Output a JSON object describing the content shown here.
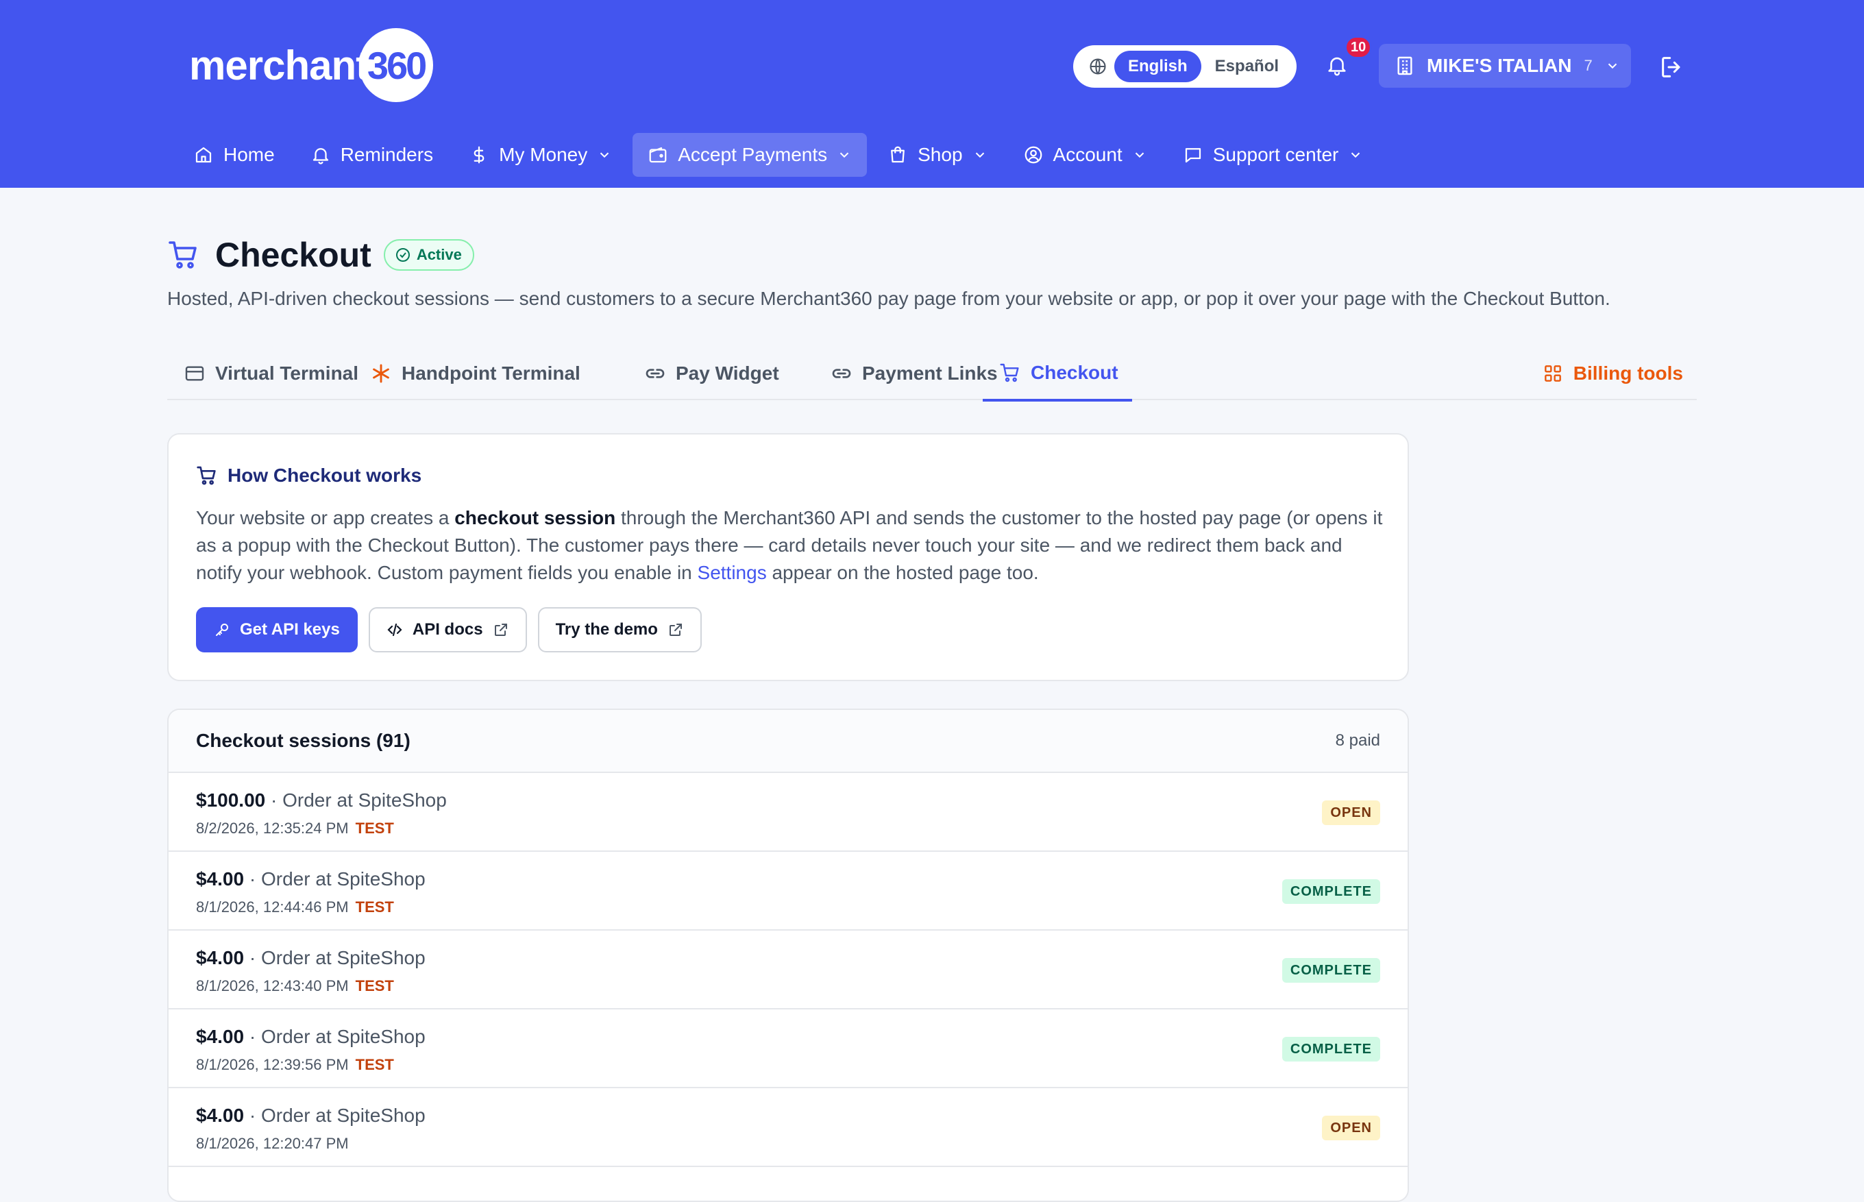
{
  "brand": {
    "logo_text": "merchant",
    "logo_badge": "360"
  },
  "header": {
    "languages": [
      {
        "label": "English",
        "active": true
      },
      {
        "label": "Español",
        "active": false
      }
    ],
    "notification_count": "10",
    "merchant_name": "MIKE'S ITALIAN",
    "merchant_count": "7"
  },
  "nav": [
    {
      "label": "Home",
      "icon": "home-icon",
      "dropdown": false,
      "active": false
    },
    {
      "label": "Reminders",
      "icon": "bell-icon",
      "dropdown": false,
      "active": false
    },
    {
      "label": "My Money",
      "icon": "dollar-icon",
      "dropdown": true,
      "active": false
    },
    {
      "label": "Accept Payments",
      "icon": "wallet-icon",
      "dropdown": true,
      "active": true
    },
    {
      "label": "Shop",
      "icon": "shopping-bag-icon",
      "dropdown": true,
      "active": false
    },
    {
      "label": "Account",
      "icon": "user-circle-icon",
      "dropdown": true,
      "active": false
    },
    {
      "label": "Support center",
      "icon": "message-icon",
      "dropdown": true,
      "active": false
    }
  ],
  "page": {
    "title": "Checkout",
    "status": "Active",
    "description": "Hosted, API-driven checkout sessions — send customers to a secure Merchant360 pay page from your website or app, or pop it over your page with the Checkout Button."
  },
  "tabs": [
    {
      "label": "Virtual Terminal",
      "icon": "credit-card-icon"
    },
    {
      "label": "Handpoint Terminal",
      "icon": "asterisk-icon"
    },
    {
      "label": "Pay Widget",
      "icon": "link-icon"
    },
    {
      "label": "Payment Links",
      "icon": "link-icon"
    },
    {
      "label": "Checkout",
      "icon": "cart-icon"
    }
  ],
  "billing_tools_label": "Billing tools",
  "info": {
    "heading": "How Checkout works",
    "body_1": "Your website or app creates a ",
    "body_bold": "checkout session",
    "body_2": " through the Merchant360 API and sends the customer to the hosted pay page (or opens it as a popup with the Checkout Button). The customer pays there — card details never touch your site — and we redirect them back and notify your webhook. Custom payment fields you enable in ",
    "body_link": "Settings",
    "body_3": " appear on the hosted page too.",
    "buttons": {
      "get_api_keys": "Get API keys",
      "api_docs": "API docs",
      "try_demo": "Try the demo"
    }
  },
  "sessions": {
    "title": "Checkout sessions (91)",
    "paid": "8 paid",
    "rows": [
      {
        "amount": "$100.00",
        "desc": " · Order at SpiteShop",
        "time": "8/2/2026, 12:35:24 PM",
        "test": "TEST",
        "status": "OPEN"
      },
      {
        "amount": "$4.00",
        "desc": " · Order at SpiteShop",
        "time": "8/1/2026, 12:44:46 PM",
        "test": "TEST",
        "status": "COMPLETE"
      },
      {
        "amount": "$4.00",
        "desc": " · Order at SpiteShop",
        "time": "8/1/2026, 12:43:40 PM",
        "test": "TEST",
        "status": "COMPLETE"
      },
      {
        "amount": "$4.00",
        "desc": " · Order at SpiteShop",
        "time": "8/1/2026, 12:39:56 PM",
        "test": "TEST",
        "status": "COMPLETE"
      },
      {
        "amount": "$4.00",
        "desc": " · Order at SpiteShop",
        "time": "8/1/2026, 12:20:47 PM",
        "test": "",
        "status": "OPEN"
      }
    ]
  },
  "colors": {
    "header_bg": "#4355ef",
    "accent": "#4355ef",
    "billing_tools": "#ea580c",
    "status_open_bg": "#fef3c7",
    "status_complete_bg": "#d1fae5"
  }
}
